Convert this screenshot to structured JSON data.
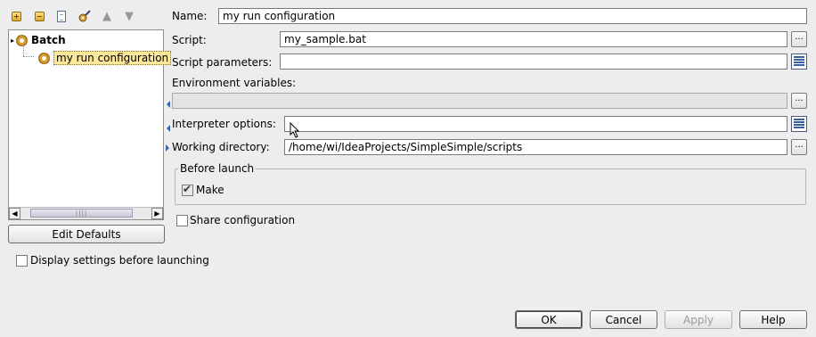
{
  "toolbar": {
    "icons": [
      "add-icon",
      "remove-icon",
      "copy-icon",
      "edit-defaults-icon",
      "move-up-icon",
      "move-down-icon"
    ]
  },
  "tree": {
    "root_label": "Batch",
    "child_label": "my run configuration"
  },
  "edit_defaults_label": "Edit Defaults",
  "display_settings_label": "Display settings before launching",
  "form": {
    "name_label": "Name:",
    "name_value": "my run configuration",
    "script_label": "Script:",
    "script_value": "my_sample.bat",
    "script_params_label": "Script parameters:",
    "script_params_value": "",
    "env_vars_label": "Environment variables:",
    "env_vars_value": "",
    "interpreter_label": "Interpreter options:",
    "interpreter_value": "",
    "workdir_label": "Working directory:",
    "workdir_value": "/home/wi/IdeaProjects/SimpleSimple/scripts",
    "ellipsis": "...",
    "before_launch_label": "Before launch",
    "make_label": "Make",
    "make_checked": true,
    "share_label": "Share configuration",
    "share_checked": false
  },
  "buttons": {
    "ok": "OK",
    "cancel": "Cancel",
    "apply": "Apply",
    "help": "Help"
  }
}
